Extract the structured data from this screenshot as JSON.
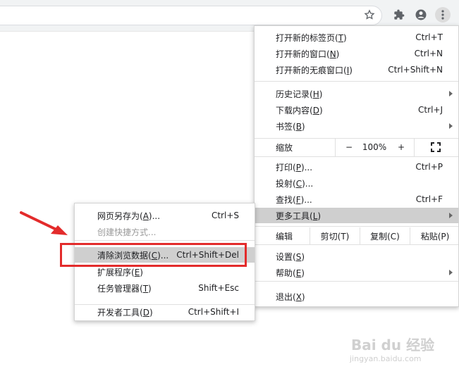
{
  "toolbar": {
    "icons": [
      "star-icon",
      "extensions-icon",
      "account-icon",
      "menu-icon"
    ]
  },
  "main_menu": {
    "items_group1": [
      {
        "label": "打开新的标签页(",
        "key": "T",
        "tail": ")",
        "shortcut": "Ctrl+T"
      },
      {
        "label": "打开新的窗口(",
        "key": "N",
        "tail": ")",
        "shortcut": "Ctrl+N"
      },
      {
        "label": "打开新的无痕窗口(",
        "key": "I",
        "tail": ")",
        "shortcut": "Ctrl+Shift+N"
      }
    ],
    "items_group2": [
      {
        "label": "历史记录(",
        "key": "H",
        "tail": ")",
        "shortcut": ""
      },
      {
        "label": "下载内容(",
        "key": "D",
        "tail": ")",
        "shortcut": "Ctrl+J"
      },
      {
        "label": "书签(",
        "key": "B",
        "tail": ")",
        "shortcut": ""
      }
    ],
    "zoom": {
      "label": "缩放",
      "minus": "−",
      "value": "100%",
      "plus": "+"
    },
    "items_group3": [
      {
        "label": "打印(",
        "key": "P",
        "tail": ")...",
        "shortcut": "Ctrl+P"
      },
      {
        "label": "投射(",
        "key": "C",
        "tail": ")...",
        "shortcut": ""
      },
      {
        "label": "查找(",
        "key": "F",
        "tail": ")...",
        "shortcut": "Ctrl+F"
      },
      {
        "label": "更多工具(",
        "key": "L",
        "tail": ")",
        "shortcut": ""
      }
    ],
    "edit": {
      "label": "编辑",
      "cut": "剪切(T)",
      "copy": "复制(C)",
      "paste": "粘贴(P)"
    },
    "items_group4": [
      {
        "label": "设置(",
        "key": "S",
        "tail": ")",
        "shortcut": ""
      },
      {
        "label": "帮助(",
        "key": "E",
        "tail": ")",
        "shortcut": ""
      }
    ],
    "exit": {
      "label": "退出(",
      "key": "X",
      "tail": ")"
    }
  },
  "sub_menu": {
    "items": [
      {
        "label": "网页另存为(",
        "key": "A",
        "tail": ")...",
        "shortcut": "Ctrl+S"
      },
      {
        "label": "创建快捷方式...",
        "key": "",
        "tail": "",
        "shortcut": ""
      },
      {
        "label": "清除浏览数据(",
        "key": "C",
        "tail": ")...",
        "shortcut": "Ctrl+Shift+Del"
      },
      {
        "label": "扩展程序(",
        "key": "E",
        "tail": ")",
        "shortcut": ""
      },
      {
        "label": "任务管理器(",
        "key": "T",
        "tail": ")",
        "shortcut": "Shift+Esc"
      },
      {
        "label": "开发者工具(",
        "key": "D",
        "tail": ")",
        "shortcut": "Ctrl+Shift+I"
      }
    ]
  },
  "watermark": {
    "logo": "Bai du 经验",
    "url": "jingyan.baidu.com"
  },
  "colors": {
    "highlight": "#cfcfcf",
    "annotation": "#e32b2b",
    "toolbar": "#f1f3f4"
  }
}
